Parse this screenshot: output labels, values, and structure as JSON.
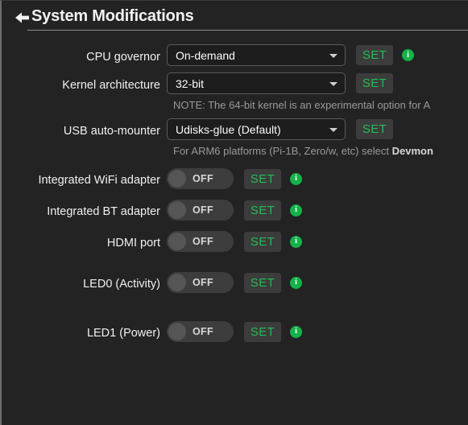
{
  "header": {
    "back_icon": "back-arrow-icon",
    "title": "System Modifications"
  },
  "rows": {
    "cpu_governor": {
      "label": "CPU governor",
      "value": "On-demand",
      "set_label": "SET",
      "info_glyph": "i"
    },
    "kernel_architecture": {
      "label": "Kernel architecture",
      "value": "32-bit",
      "set_label": "SET",
      "note": "NOTE: The 64-bit kernel is an experimental option for A"
    },
    "usb_auto_mounter": {
      "label": "USB auto-mounter",
      "value": "Udisks-glue (Default)",
      "set_label": "SET",
      "note_prefix": "For ARM6 platforms (Pi-1B, Zero/w, etc) select ",
      "note_bold": "Devmon"
    },
    "wifi": {
      "label": "Integrated WiFi adapter",
      "state": "OFF",
      "set_label": "SET",
      "info_glyph": "i"
    },
    "bt": {
      "label": "Integrated BT adapter",
      "state": "OFF",
      "set_label": "SET",
      "info_glyph": "i"
    },
    "hdmi": {
      "label": "HDMI port",
      "state": "OFF",
      "set_label": "SET",
      "info_glyph": "i"
    },
    "led0": {
      "label": "LED0 (Activity)",
      "state": "OFF",
      "set_label": "SET",
      "info_glyph": "i"
    },
    "led1": {
      "label": "LED1 (Power)",
      "state": "OFF",
      "set_label": "SET",
      "info_glyph": "i"
    }
  },
  "colors": {
    "background": "#232323",
    "accent_green": "#1fbf55",
    "info_green": "#14b24a",
    "field_background": "#1d1d1d",
    "field_border": "#5a5a5a",
    "toggle_track": "#3d3d3d",
    "toggle_knob": "#555555",
    "note_text": "#9a9a9a"
  }
}
